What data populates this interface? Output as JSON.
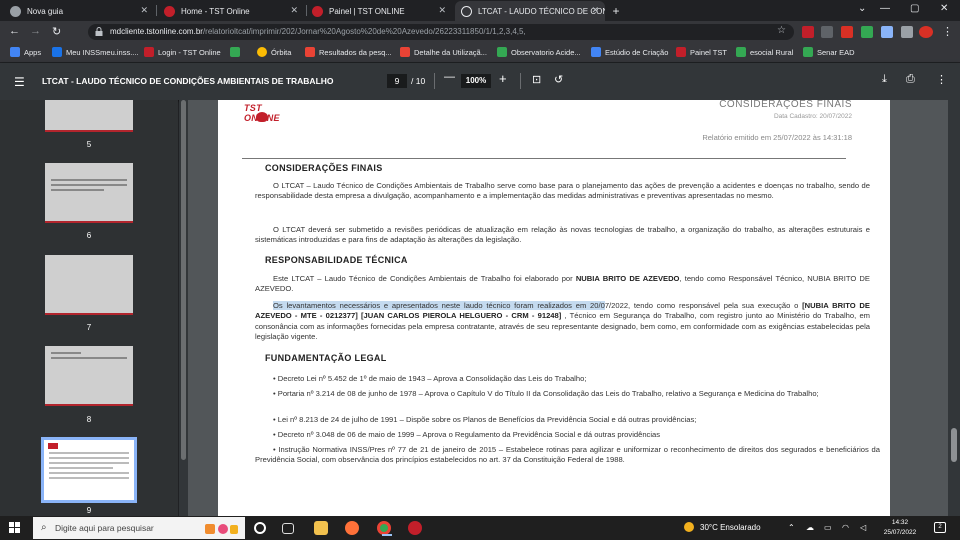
{
  "browser": {
    "tabs": [
      {
        "title": "Nova guia",
        "favicon_color": "#9aa0a6"
      },
      {
        "title": "Home - TST Online",
        "favicon_color": "#c21f2a"
      },
      {
        "title": "Painel | TST ONLINE",
        "favicon_color": "#c21f2a"
      },
      {
        "title": "LTCAT - LAUDO TÉCNICO DE CON",
        "favicon_color": "#e8eaed",
        "active": true
      }
    ],
    "url_host": "mdcliente.tstonline.com.br",
    "url_path": "/relatorioltcat/imprimir/202/Jornar%20Agosto%20de%20Azevedo/26223311850/1/1,2,3,4,5,"
  },
  "bookmarks": [
    {
      "label": "Apps",
      "color": "#4285f4"
    },
    {
      "label": "Meu INSSmeu.inss....",
      "color": "#1a73e8"
    },
    {
      "label": "Login - TST Online",
      "color": "#c21f2a"
    },
    {
      "label": "",
      "color": "#34a853"
    },
    {
      "label": "Órbita",
      "color": "#fbbc04"
    },
    {
      "label": "Resultados da pesq...",
      "color": "#ea4335"
    },
    {
      "label": "Detalhe da Utilizaçã...",
      "color": "#ea4335"
    },
    {
      "label": "Observatorio Acide...",
      "color": "#34a853"
    },
    {
      "label": "Estúdio de Criação",
      "color": "#4285f4"
    },
    {
      "label": "Painel TST",
      "color": "#c21f2a"
    },
    {
      "label": "esocial Rural",
      "color": "#34a853"
    },
    {
      "label": "Senar EAD",
      "color": "#34a853"
    }
  ],
  "pdf": {
    "title": "LTCAT - LAUDO TÉCNICO DE CONDIÇÕES AMBIENTAIS DE TRABALHO",
    "current_page": "9",
    "total_pages": "/ 10",
    "zoom": "100%"
  },
  "thumbnails": [
    "5",
    "6",
    "7",
    "8",
    "9"
  ],
  "document": {
    "logo_text": "TST ONLINE",
    "header_title": "CONSIDERAÇÕES FINAIS",
    "header_date": "Data Cadastro: 20/07/2022",
    "header_report": "Relatório emitido em 25/07/2022 às 14:31:18",
    "sec1_title": "CONSIDERAÇÕES FINAIS",
    "sec1_p1": "O LTCAT – Laudo Técnico de Condições Ambientais de Trabalho serve como base para o planejamento das ações de prevenção a acidentes e doenças no trabalho, sendo de responsabilidade desta empresa a divulgação, acompanhamento e a implementação das medidas administrativas e preventivas apresentadas no mesmo.",
    "sec1_p2": "O LTCAT deverá ser submetido a revisões periódicas de atualização em relação às novas tecnologias de trabalho, a organização do trabalho, as alterações estruturais e sistemáticas introduzidas e para fins de adaptação às alterações da legislação.",
    "sec2_title": "RESPONSABILIDADE TÉCNICA",
    "sec2_p1_a": "Este LTCAT – Laudo Técnico de Condições Ambientais de Trabalho foi elaborado por ",
    "sec2_p1_name": "NUBIA BRITO DE AZEVEDO",
    "sec2_p1_b": ", tendo como Responsável Técnico, NUBIA BRITO DE AZEVEDO.",
    "sec2_p2_hl": "Os levantamentos necessários e apresentados neste laudo técnico foram realizados em 20/0",
    "sec2_p2_a": "7/2022, tendo como responsável pela sua execução o ",
    "sec2_p2_names": "[NUBIA BRITO DE AZEVEDO - MTE - 0212377] [JUAN CARLOS PIEROLA HELGUERO - CRM - 91248]",
    "sec2_p2_b": " , Técnico em Segurança do Trabalho, com registro junto ao Ministério do Trabalho, em consonância com as informações fornecidas pela empresa contratante, através de seu representante designado, bem como, em conformidade com as exigências estabelecidas pela legislação vigente.",
    "sec3_title": "FUNDAMENTAÇÃO LEGAL",
    "bullets": [
      "• Decreto Lei nº 5.452 de 1º de maio de 1943 – Aprova a Consolidação das Leis do Trabalho;",
      "• Portaria nº 3.214 de 08 de junho de 1978 – Aprova o Capítulo V do Título II da Consolidação das Leis do Trabalho, relativo a Segurança e Medicina do Trabalho;",
      "• Lei nº 8.213 de 24 de julho de 1991 – Dispõe sobre os Planos de Benefícios da Previdência Social e dá outras providências;",
      "• Decreto nº 3.048 de 06 de maio de 1999 – Aprova o Regulamento da Previdência Social e dá outras providências",
      "• Instrução Normativa INSS/Pres nº 77 de 21 de janeiro de 2015 – Estabelece rotinas para agilizar e uniformizar o reconhecimento de direitos dos segurados e beneficiários da Previdência Social, com observância dos princípios estabelecidos no art. 37 da Constituição Federal de 1988."
    ]
  },
  "taskbar": {
    "search_placeholder": "Digite aqui para pesquisar",
    "weather": "30°C  Ensolarado",
    "time": "14:32",
    "date": "25/07/2022",
    "notifications": "2"
  }
}
